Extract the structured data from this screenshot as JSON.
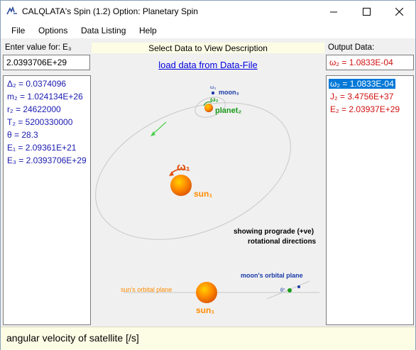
{
  "app": {
    "title": "CALQLATA's  Spin (1.2)  Option: Planetary Spin"
  },
  "menu": [
    "File",
    "Options",
    "Data Listing",
    "Help"
  ],
  "input": {
    "label": "Enter value for: E₃",
    "value": "2.0393706E+29"
  },
  "description": {
    "label": "Select Data to View Description",
    "link": "load data from Data-File"
  },
  "output": {
    "label": "Output Data:",
    "value": "ω₂ = 1.0833E-04",
    "items": [
      "ω₂ = 1.0833E-04",
      "J₂ = 3.4756E+37",
      "E₂ = 2.03937E+29"
    ]
  },
  "inputs_list": [
    "Δ₂ = 0.0374096",
    "m₂ = 1.024134E+26",
    "r₂ = 24622000",
    "T₂ = 5200330000",
    "θ = 28.3",
    "E₁ = 2.09361E+21",
    "E₃ = 2.0393706E+29"
  ],
  "diagram": {
    "sun_label": "sun₁",
    "omega1": "ω₁",
    "planet_label": "planet₂",
    "omega2": "ω₂",
    "moon_label": "moon₃",
    "omega3": "ω₃",
    "caption_line1": "showing prograde (+ve)",
    "caption_line2": "rotational directions",
    "suns_plane": "sun's orbital plane",
    "moons_plane": "moon's orbital plane",
    "sun_label_bottom": "sun₁",
    "theta_mark": "θ°",
    "colors": {
      "sun": "#ff8c00",
      "planet": "#1a9a1a",
      "moon": "#1a3aa8",
      "omega_red": "#e05010"
    }
  },
  "status": {
    "text": "angular velocity of satellite [/s]"
  }
}
